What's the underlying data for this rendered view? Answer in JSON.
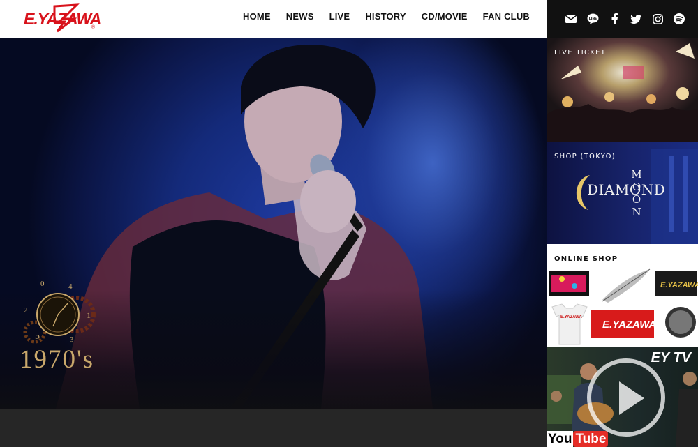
{
  "brand": {
    "logo_text": "E.YAZAWA",
    "logo_mark": "Z",
    "registered": "®",
    "brand_color": "#d8121b"
  },
  "nav": {
    "items": [
      {
        "label": "HOME"
      },
      {
        "label": "NEWS"
      },
      {
        "label": "LIVE"
      },
      {
        "label": "HISTORY"
      },
      {
        "label": "CD/MOVIE"
      },
      {
        "label": "FAN CLUB"
      }
    ]
  },
  "social": {
    "icons": [
      "mail-icon",
      "line-icon",
      "facebook-icon",
      "twitter-icon",
      "instagram-icon",
      "spotify-icon"
    ]
  },
  "hero": {
    "era_label": "1970's",
    "clock_numbers": [
      "0",
      "1",
      "2",
      "3",
      "4",
      "5"
    ],
    "accent_color": "#c9a86b"
  },
  "side": {
    "live_ticket": {
      "label": "LIVE TICKET"
    },
    "shop_tokyo": {
      "label": "SHOP (TOKYO)",
      "logo_word": "DIAMOND",
      "logo_vertical": "MOON"
    },
    "online_shop": {
      "label": "ONLINE SHOP",
      "product_text": "E.YAZAWA"
    },
    "ey_tv": {
      "label": "EY TV",
      "youtube_you": "You",
      "youtube_tube": "Tube"
    }
  }
}
